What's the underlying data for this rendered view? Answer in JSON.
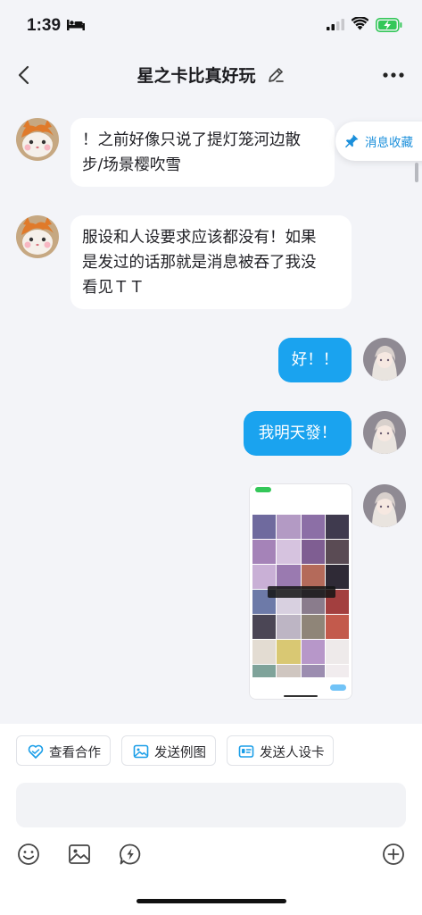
{
  "status_bar": {
    "time": "1:39"
  },
  "header": {
    "title": "星之卡比真好玩"
  },
  "favorite_pill": {
    "label": "消息收藏"
  },
  "messages": [
    {
      "side": "left",
      "lines": [
        "！之前好像只说了提灯笼河边散",
        "步/场景樱吹雪"
      ]
    },
    {
      "side": "left",
      "lines": [
        "服设和人设要求应该都没有！如果",
        "是发过的话那就是消息被吞了我没",
        "看见ＴＴ"
      ]
    },
    {
      "side": "right",
      "lines": [
        "好！！"
      ]
    },
    {
      "side": "right",
      "lines": [
        "我明天發！"
      ]
    },
    {
      "side": "right",
      "type": "image"
    }
  ],
  "quick_actions": [
    {
      "label": "查看合作",
      "icon": "heart-handshake-icon"
    },
    {
      "label": "发送例图",
      "icon": "image-icon"
    },
    {
      "label": "发送人设卡",
      "icon": "id-card-icon"
    }
  ],
  "colors": {
    "accent": "#1aa3ef",
    "background": "#f3f4f8"
  }
}
